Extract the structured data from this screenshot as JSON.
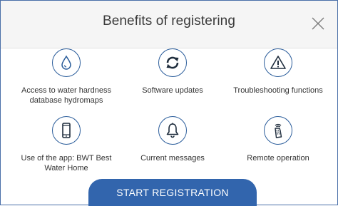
{
  "dialog": {
    "title": "Benefits of registering"
  },
  "benefits": [
    {
      "icon": "water-drop-icon",
      "label": "Access to water hardness database hydromaps"
    },
    {
      "icon": "refresh-icon",
      "label": "Software updates"
    },
    {
      "icon": "warning-icon",
      "label": "Troubleshooting functions"
    },
    {
      "icon": "smartphone-icon",
      "label": "Use of the app: BWT Best Water Home"
    },
    {
      "icon": "bell-icon",
      "label": "Current messages"
    },
    {
      "icon": "remote-control-icon",
      "label": "Remote operation"
    }
  ],
  "start_button": {
    "label": "START REGISTRATION"
  },
  "colors": {
    "accent": "#3265ad",
    "icon_stroke": "#2b5d9b",
    "header_bg": "#f5f5f5"
  }
}
